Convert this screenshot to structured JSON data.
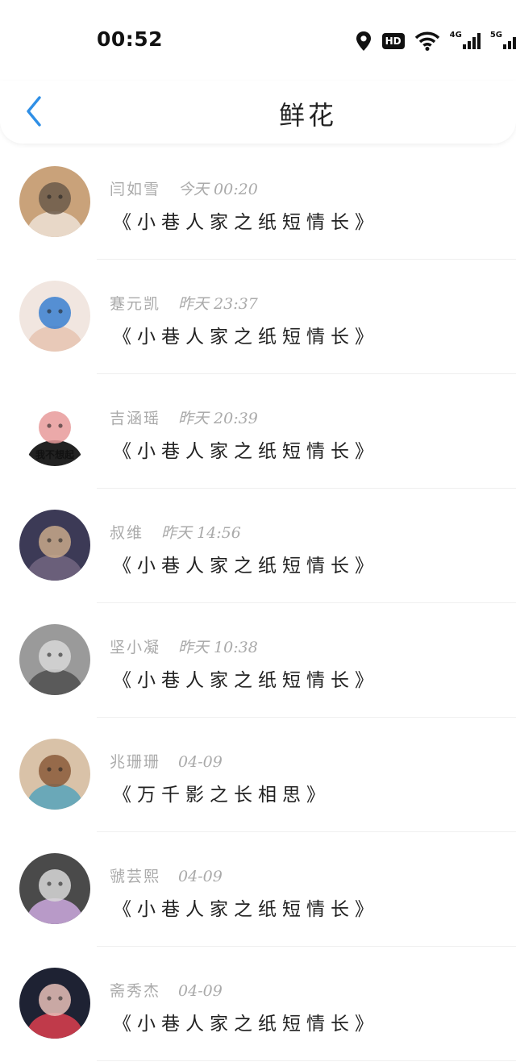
{
  "status_bar": {
    "time": "00:52",
    "icons": [
      "location-icon",
      "hd-icon",
      "wifi-icon",
      "signal-4g-icon",
      "signal-5g-icon"
    ],
    "hd_label": "HD",
    "net1_label": "4G",
    "net2_label": "5G"
  },
  "header": {
    "title": "鲜花",
    "back_icon": "chevron-left-icon",
    "accent": "#2f8fe6"
  },
  "messages": [
    {
      "name": "闫如雪",
      "time": "今天 00:20",
      "title": "《小巷人家之纸短情长》",
      "avatar_colors": [
        "#c9a27a",
        "#6b5a4a",
        "#e8d8c8"
      ]
    },
    {
      "name": "蹇元凯",
      "time": "昨天 23:37",
      "title": "《小巷人家之纸短情长》",
      "avatar_colors": [
        "#f1e6e0",
        "#3a7fd0",
        "#e8c9b8"
      ]
    },
    {
      "name": "吉涵瑶",
      "time": "昨天 20:39",
      "title": "《小巷人家之纸短情长》",
      "avatar_colors": [
        "#ffffff",
        "#e89a9a",
        "#222222"
      ],
      "avatar_caption": "我不想起"
    },
    {
      "name": "叔维",
      "time": "昨天 14:56",
      "title": "《小巷人家之纸短情长》",
      "avatar_colors": [
        "#3c3a56",
        "#c8a98a",
        "#6a5f7a"
      ]
    },
    {
      "name": "坚小凝",
      "time": "昨天 10:38",
      "title": "《小巷人家之纸短情长》",
      "avatar_colors": [
        "#9a9a9a",
        "#d8d8d8",
        "#5a5a5a"
      ]
    },
    {
      "name": "兆珊珊",
      "time": "04-09",
      "title": "《万千影之长相思》",
      "avatar_colors": [
        "#d9c2a8",
        "#8a5a3a",
        "#6aa8b8"
      ]
    },
    {
      "name": "虢芸熙",
      "time": "04-09",
      "title": "《小巷人家之纸短情长》",
      "avatar_colors": [
        "#4a4a4a",
        "#d8d8d8",
        "#b89ac8"
      ]
    },
    {
      "name": "斋秀杰",
      "time": "04-09",
      "title": "《小巷人家之纸短情长》",
      "avatar_colors": [
        "#1e2233",
        "#e8c0b8",
        "#c03a4a"
      ]
    }
  ]
}
